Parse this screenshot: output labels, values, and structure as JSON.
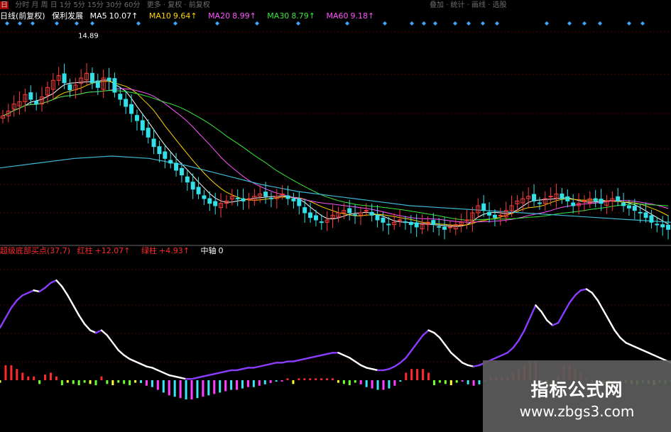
{
  "colors": {
    "background": "#000000",
    "grid": "#5a0000",
    "up_candle": "#ff3b3b",
    "down_candle": "#33e0e8",
    "ma5": "#ffffff",
    "ma10": "#ffd400",
    "ma20": "#ff55ff",
    "ma30": "#39e639",
    "ma60": "#3fb8d8",
    "indicator_line": "#ffffff",
    "indicator_line_purple": "#8a3cff",
    "bar_red": "#ff2a2a",
    "bar_green": "#6cff2a",
    "bar_yellow": "#ffff33",
    "bar_cyan": "#3ae6f0",
    "bar_magenta": "#ff3cff",
    "marker": "#3aa6ff"
  },
  "toolbar": {
    "left_text": "分时 月 周 日 1分 5分 15分 30分 60分",
    "mid_text": "更多 · 复权 · 前复权",
    "right_text": "叠加 · 统计 · 画线 · 选股"
  },
  "chart_data": [
    {
      "type": "candlestick",
      "title": "日线(前复权)",
      "subtitle": "保利发展",
      "legend": [
        {
          "name": "MA5",
          "value": "10.07↑",
          "color": "#ffffff"
        },
        {
          "name": "MA10",
          "value": "9.64↑",
          "color": "#ffd400"
        },
        {
          "name": "MA20",
          "value": "8.99↑",
          "color": "#ff55ff"
        },
        {
          "name": "MA30",
          "value": "8.79↑",
          "color": "#39e639"
        },
        {
          "name": "MA60",
          "value": "9.18↑",
          "color": "#3fb8d8"
        }
      ],
      "annotations": [
        {
          "text": "14.89",
          "label": "period high"
        }
      ],
      "ylim": [
        6.4,
        15.4
      ],
      "grid": true,
      "legend_placement": "top-left",
      "n": 120,
      "close": [
        11.4,
        11.6,
        11.9,
        12.0,
        12.3,
        12.1,
        11.9,
        12.2,
        12.6,
        12.9,
        13.1,
        12.8,
        12.5,
        12.7,
        13.0,
        13.2,
        12.8,
        12.6,
        13.0,
        12.9,
        12.4,
        12.1,
        11.8,
        11.5,
        11.2,
        10.8,
        10.5,
        10.1,
        9.8,
        9.6,
        9.4,
        9.1,
        8.9,
        8.6,
        8.3,
        8.1,
        7.9,
        7.7,
        7.6,
        7.7,
        7.8,
        8.0,
        7.9,
        7.8,
        7.9,
        8.0,
        8.1,
        8.0,
        7.9,
        8.0,
        8.1,
        7.9,
        7.8,
        7.6,
        7.3,
        7.1,
        7.0,
        6.9,
        7.0,
        7.2,
        7.3,
        7.4,
        7.3,
        7.2,
        7.3,
        7.4,
        7.2,
        7.0,
        6.9,
        6.8,
        6.9,
        7.0,
        6.9,
        6.8,
        6.7,
        6.8,
        6.9,
        6.8,
        6.7,
        6.6,
        6.7,
        6.8,
        6.9,
        7.0,
        7.3,
        7.6,
        7.4,
        7.2,
        7.1,
        7.2,
        7.4,
        7.6,
        7.8,
        7.9,
        8.0,
        7.8,
        7.7,
        7.9,
        8.0,
        8.1,
        7.9,
        7.8,
        7.6,
        7.7,
        7.8,
        7.9,
        7.8,
        7.7,
        7.8,
        7.9,
        7.8,
        7.6,
        7.5,
        7.4,
        7.3,
        7.1,
        6.9,
        6.8,
        6.7,
        6.6
      ],
      "ma5_summary": "follows close with short lag",
      "ma60_path": [
        9.2,
        9.4,
        9.6,
        9.7,
        9.6,
        9.3,
        8.9,
        8.5,
        8.2,
        8.0,
        7.8,
        7.6,
        7.5,
        7.4,
        7.3,
        7.2,
        7.1,
        7.0,
        6.9
      ]
    },
    {
      "type": "line_bar",
      "title": "超级底部买点(37,7)",
      "legend": [
        {
          "name": "红柱",
          "value": "+12.07↑",
          "color": "#ff2a2a"
        },
        {
          "name": "绿柱",
          "value": "+4.93↑",
          "color": "#ff2a2a"
        },
        {
          "name": "中轴",
          "value": "0",
          "color": "#ffffff"
        }
      ],
      "ylim": [
        -25,
        100
      ],
      "grid": true,
      "legend_placement": "top-left",
      "line": [
        42,
        50,
        58,
        64,
        68,
        70,
        72,
        71,
        74,
        78,
        80,
        75,
        68,
        60,
        52,
        45,
        40,
        38,
        40,
        36,
        30,
        24,
        20,
        17,
        15,
        13,
        11,
        10,
        8,
        6,
        4,
        3,
        2,
        1,
        1,
        2,
        3,
        4,
        5,
        6,
        7,
        8,
        8,
        9,
        10,
        10,
        11,
        12,
        13,
        14,
        14,
        15,
        15,
        16,
        17,
        18,
        19,
        20,
        21,
        22,
        22,
        20,
        18,
        15,
        12,
        10,
        9,
        8,
        8,
        9,
        11,
        14,
        18,
        24,
        30,
        36,
        40,
        38,
        34,
        28,
        22,
        18,
        14,
        12,
        11,
        12,
        14,
        16,
        18,
        20,
        22,
        26,
        32,
        40,
        50,
        60,
        55,
        48,
        44,
        46,
        54,
        62,
        68,
        72,
        73,
        70,
        64,
        56,
        48,
        40,
        34,
        30,
        28,
        26,
        24,
        22,
        20,
        18,
        16,
        14
      ]
    }
  ],
  "watermark": {
    "title": "指标公式网",
    "url": "www.zbgs3.com"
  }
}
